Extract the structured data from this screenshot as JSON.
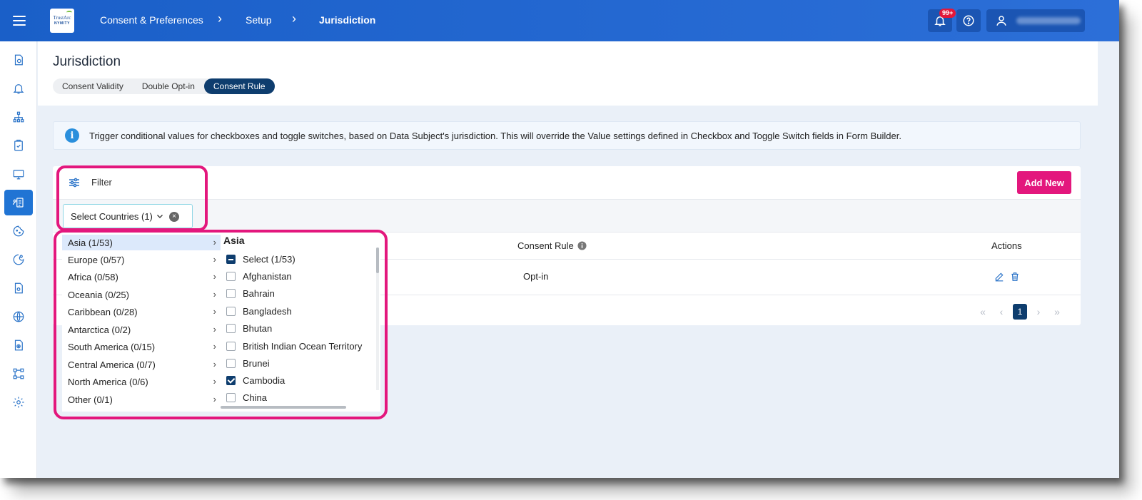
{
  "breadcrumb": {
    "item1": "Consent & Preferences",
    "item2": "Setup",
    "current": "Jurisdiction",
    "sep": "›"
  },
  "logo": {
    "line1": "TrustArc",
    "line2": "NYMITY"
  },
  "notifications": {
    "badge": "99+"
  },
  "page": {
    "title": "Jurisdiction"
  },
  "tabs": [
    {
      "label": "Consent Validity",
      "active": false
    },
    {
      "label": "Double Opt-in",
      "active": false
    },
    {
      "label": "Consent Rule",
      "active": true
    }
  ],
  "info": {
    "icon": "i",
    "text": "Trigger conditional values for checkboxes and toggle switches, based on Data Subject's jurisdiction. This will override the Value settings defined in Checkbox and Toggle Switch fields in Form Builder."
  },
  "filter": {
    "label": "Filter",
    "select_label": "Select Countries (1)",
    "clear": "×"
  },
  "toolbar": {
    "add_new": "Add New"
  },
  "table": {
    "columns": {
      "rule": "Consent Rule",
      "actions": "Actions"
    },
    "rows": [
      {
        "rule": "Opt-in"
      }
    ]
  },
  "pagination": {
    "first": "«",
    "prev": "‹",
    "current": "1",
    "next": "›",
    "last": "»"
  },
  "regions": [
    {
      "label": "Asia (1/53)",
      "active": true
    },
    {
      "label": "Europe (0/57)"
    },
    {
      "label": "Africa (0/58)"
    },
    {
      "label": "Oceania (0/25)"
    },
    {
      "label": "Caribbean (0/28)"
    },
    {
      "label": "Antarctica (0/2)"
    },
    {
      "label": "South America (0/15)"
    },
    {
      "label": "Central America (0/7)"
    },
    {
      "label": "North America (0/6)"
    },
    {
      "label": "Other (0/1)"
    }
  ],
  "region_chevron": "›",
  "country_panel": {
    "title": "Asia",
    "items": [
      {
        "label": "Select (1/53)",
        "state": "indeterminate"
      },
      {
        "label": "Afghanistan",
        "state": "unchecked"
      },
      {
        "label": "Bahrain",
        "state": "unchecked"
      },
      {
        "label": "Bangladesh",
        "state": "unchecked"
      },
      {
        "label": "Bhutan",
        "state": "unchecked"
      },
      {
        "label": "British Indian Ocean Territory",
        "state": "unchecked"
      },
      {
        "label": "Brunei",
        "state": "unchecked"
      },
      {
        "label": "Cambodia",
        "state": "checked"
      },
      {
        "label": "China",
        "state": "unchecked"
      }
    ]
  },
  "colors": {
    "topbar": "#1a5fc8",
    "accent": "#e3177d",
    "navy": "#0e3d6e",
    "sidebar_active": "#2074d4"
  }
}
